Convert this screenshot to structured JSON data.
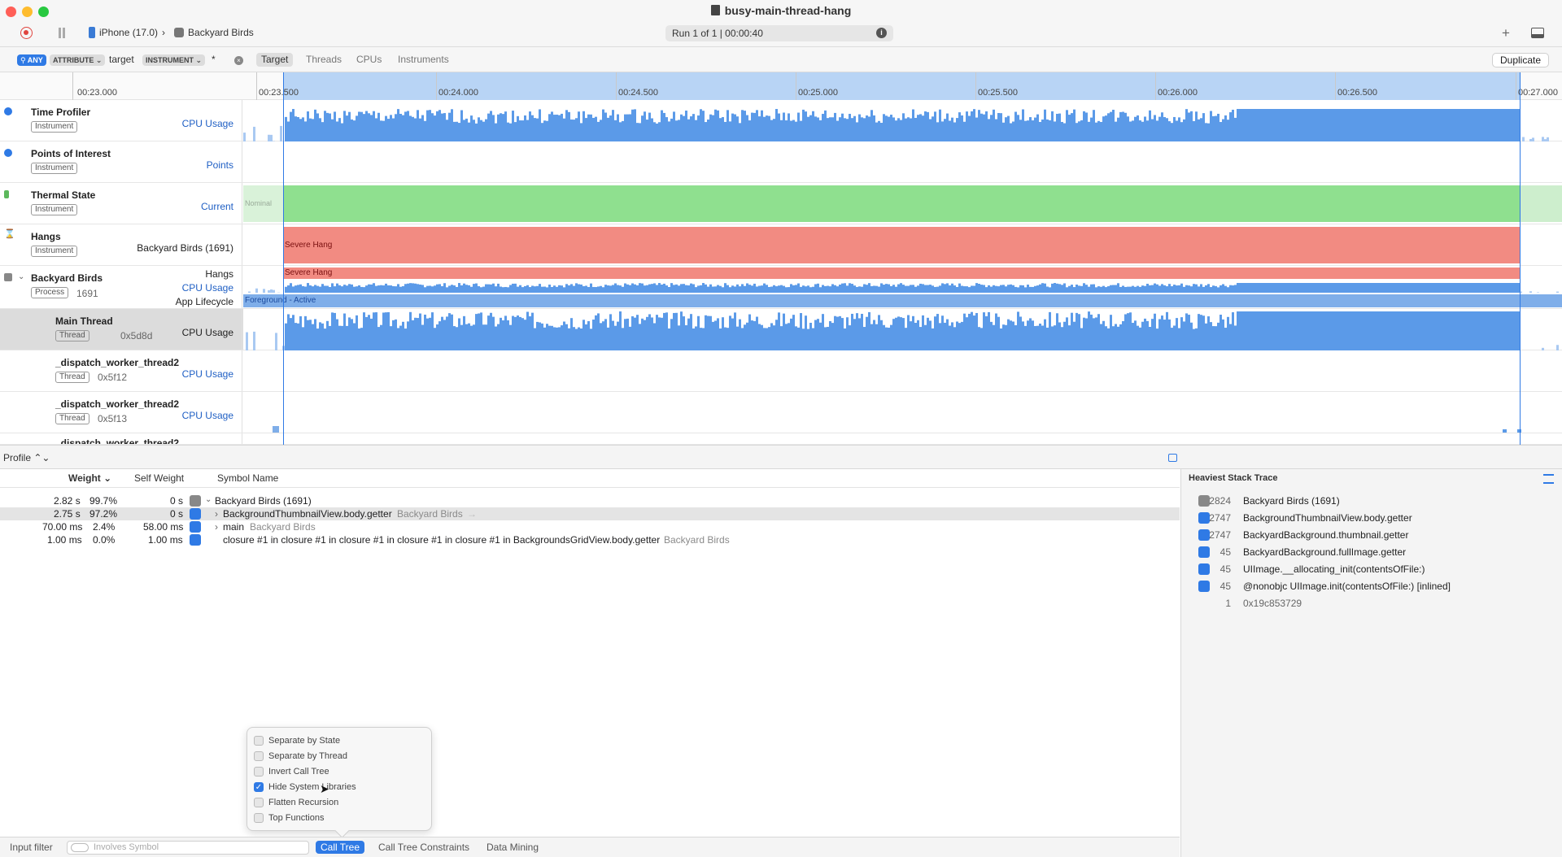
{
  "window": {
    "title": "busy-main-thread-hang"
  },
  "toolbar": {
    "device": "iPhone (17.0)",
    "app": "Backyard Birds",
    "run": "Run 1 of 1  |  00:00:40"
  },
  "filter": {
    "any": "ANY",
    "attribute": "ATTRIBUTE",
    "term": "target",
    "instrument": "INSTRUMENT",
    "wildcard": "*",
    "scopes": [
      "Target",
      "Threads",
      "CPUs",
      "Instruments"
    ],
    "duplicate": "Duplicate"
  },
  "ruler": {
    "ticks": [
      "00:23.000",
      "00:23.500",
      "00:24.000",
      "00:24.500",
      "00:25.000",
      "00:25.500",
      "00:26.000",
      "00:26.500",
      "00:27.000"
    ]
  },
  "tracks": [
    {
      "name": "Time Profiler",
      "badge": "Instrument",
      "sub": "CPU Usage"
    },
    {
      "name": "Points of Interest",
      "badge": "Instrument",
      "sub": "Points"
    },
    {
      "name": "Thermal State",
      "badge": "Instrument",
      "sub": "Current",
      "lane": "Nominal"
    },
    {
      "name": "Hangs",
      "badge": "Instrument",
      "sub": "Backyard Birds (1691)",
      "lane": "Severe Hang"
    },
    {
      "name": "Backyard Birds",
      "badge": "Process",
      "pid": "1691",
      "subs": [
        "Hangs",
        "CPU Usage",
        "App Lifecycle"
      ],
      "hang": "Severe Hang",
      "lifecycle": "Foreground - Active"
    },
    {
      "name": "Main Thread",
      "badge": "Thread",
      "hex": "0x5d8d",
      "sub": "CPU Usage"
    },
    {
      "name": "_dispatch_worker_thread2",
      "badge": "Thread",
      "hex": "0x5f12",
      "sub": "CPU Usage"
    },
    {
      "name": "_dispatch_worker_thread2",
      "badge": "Thread",
      "hex": "0x5f13",
      "sub": "CPU Usage"
    },
    {
      "name": "_dispatch_worker_thread2"
    }
  ],
  "profile": {
    "selector": "Profile",
    "columns": [
      "Weight",
      "Self Weight",
      "Symbol Name"
    ]
  },
  "calltree": [
    {
      "w": "2.82 s",
      "pct": "99.7%",
      "self": "0 s",
      "sym": "Backyard Birds (1691)",
      "lib": ""
    },
    {
      "w": "2.75 s",
      "pct": "97.2%",
      "self": "0 s",
      "sym": "BackgroundThumbnailView.body.getter",
      "lib": "Backyard Birds"
    },
    {
      "w": "70.00 ms",
      "pct": "2.4%",
      "self": "58.00 ms",
      "sym": "main",
      "lib": "Backyard Birds"
    },
    {
      "w": "1.00 ms",
      "pct": "0.0%",
      "self": "1.00 ms",
      "sym": "closure #1 in closure #1 in closure #1 in closure #1 in closure #1 in BackgroundsGridView.body.getter",
      "lib": "Backyard Birds"
    }
  ],
  "heaviest": {
    "title": "Heaviest Stack Trace",
    "rows": [
      {
        "n": "2824",
        "s": "Backyard Birds (1691)"
      },
      {
        "n": "2747",
        "s": "BackgroundThumbnailView.body.getter"
      },
      {
        "n": "2747",
        "s": "BackyardBackground.thumbnail.getter"
      },
      {
        "n": "45",
        "s": "BackyardBackground.fullImage.getter"
      },
      {
        "n": "45",
        "s": "UIImage.__allocating_init(contentsOfFile:)"
      },
      {
        "n": "45",
        "s": "@nonobjc UIImage.init(contentsOfFile:) [inlined]"
      },
      {
        "n": "1",
        "s": "0x19c853729"
      }
    ]
  },
  "popup": {
    "options": [
      "Separate by State",
      "Separate by Thread",
      "Invert Call Tree",
      "Hide System Libraries",
      "Flatten Recursion",
      "Top Functions"
    ],
    "checked": [
      false,
      false,
      false,
      true,
      false,
      false
    ]
  },
  "bottom": {
    "label": "Input filter",
    "placeholder": "Involves Symbol",
    "tabs": [
      "Call Tree",
      "Call Tree Constraints",
      "Data Mining"
    ]
  },
  "colors": {
    "accent": "#2f7ae5",
    "cpu": "#5b9ae8",
    "thermal": "#8fe08f",
    "hang": "#f28b82"
  }
}
